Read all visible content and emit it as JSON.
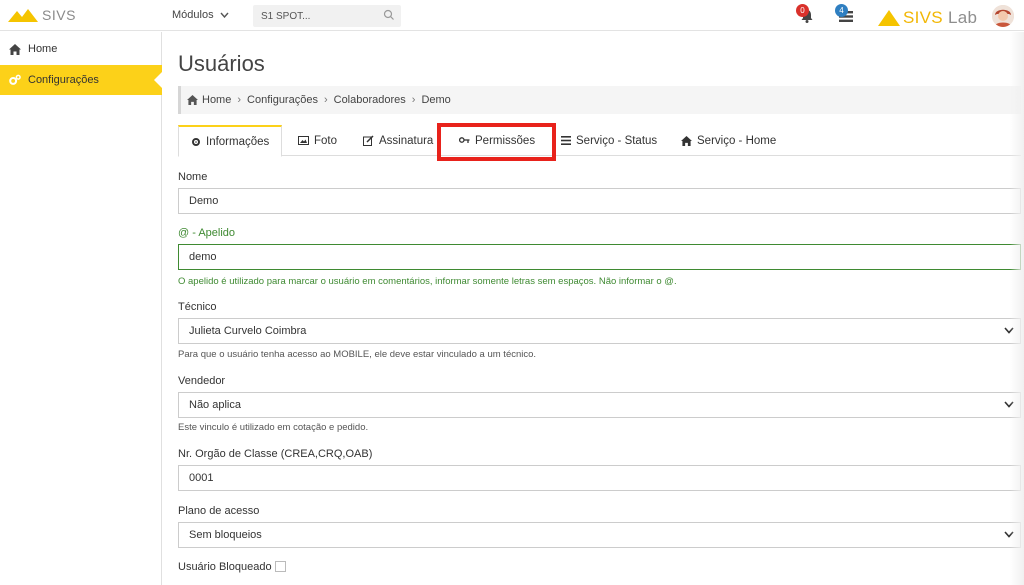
{
  "topbar": {
    "logo_text": "SIVS",
    "modulos_label": "Módulos",
    "search_value": "S1 SPOT...",
    "notif_count": "0",
    "tasks_count": "4",
    "brand_left": "SIVS",
    "brand_right": "Lab"
  },
  "sidebar": {
    "items": [
      {
        "label": "Home",
        "icon": "home-icon"
      },
      {
        "label": "Configurações",
        "icon": "cogs-icon"
      }
    ]
  },
  "page": {
    "title": "Usuários",
    "breadcrumb": [
      "Home",
      "Configurações",
      "Colaboradores",
      "Demo"
    ]
  },
  "tabs": [
    {
      "label": "Informações",
      "icon": "gear-icon"
    },
    {
      "label": "Foto",
      "icon": "image-icon"
    },
    {
      "label": "Assinatura",
      "icon": "edit-icon"
    },
    {
      "label": "Permissões",
      "icon": "key-icon"
    },
    {
      "label": "Serviço - Status",
      "icon": "list-icon"
    },
    {
      "label": "Serviço - Home",
      "icon": "home-icon"
    }
  ],
  "form": {
    "nome_label": "Nome",
    "nome_value": "Demo",
    "apelido_label": "@ - Apelido",
    "apelido_value": "demo",
    "apelido_help": "O apelido é utilizado para marcar o usuário em comentários, informar somente letras sem espaços. Não informar o @.",
    "tecnico_label": "Técnico",
    "tecnico_value": "Julieta Curvelo Coimbra",
    "tecnico_help": "Para que o usuário tenha acesso ao MOBILE, ele deve estar vinculado a um técnico.",
    "vendedor_label": "Vendedor",
    "vendedor_value": "Não aplica",
    "vendedor_help": "Este vinculo é utilizado em cotação e pedido.",
    "orgao_label": "Nr. Orgão de Classe (CREA,CRQ,OAB)",
    "orgao_value": "0001",
    "plano_label": "Plano de acesso",
    "plano_value": "Sem bloqueios",
    "bloqueado_label": "Usuário Bloqueado"
  },
  "colors": {
    "accent": "#fcd119",
    "highlight": "#e8221b",
    "valid": "#3f8a32"
  }
}
